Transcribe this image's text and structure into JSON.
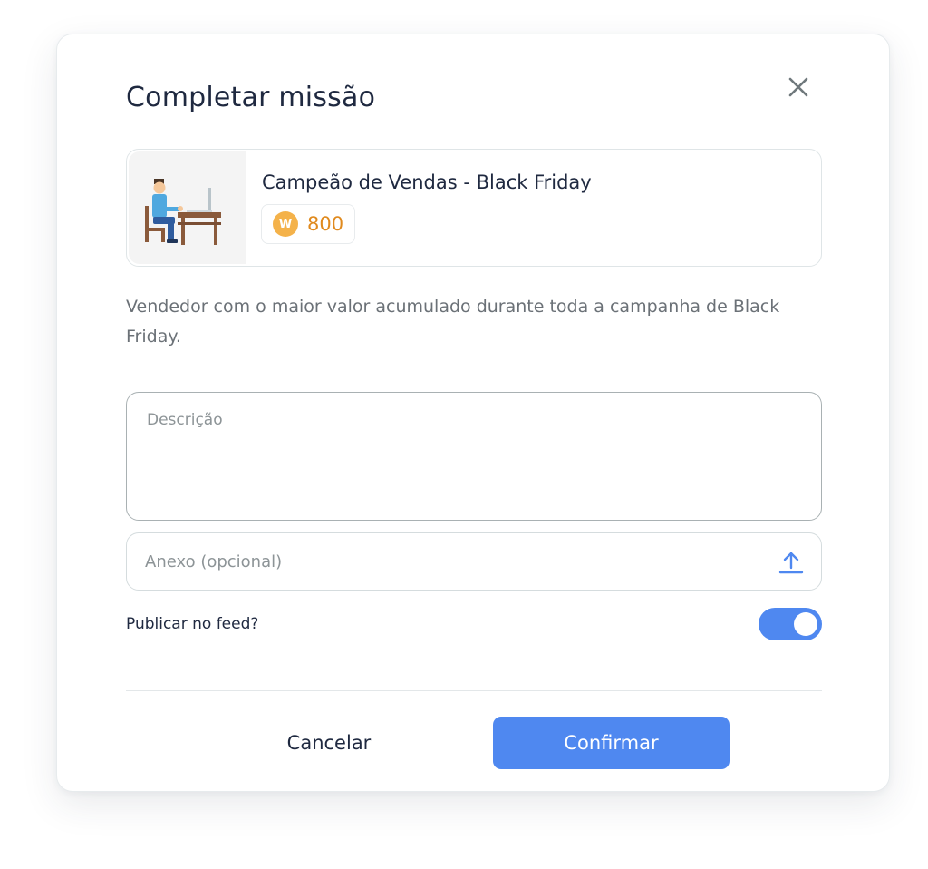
{
  "modal": {
    "title": "Completar missão",
    "close_icon": "close-icon"
  },
  "mission": {
    "image_icon": "person-at-desk-illustration",
    "name": "Campeão de Vendas - Black Friday",
    "coin_letter": "W",
    "points": "800",
    "description": "Vendedor com o maior valor acumulado durante toda a campanha de Black Friday."
  },
  "form": {
    "description_placeholder": "Descrição",
    "description_value": "",
    "attachment_label": "Anexo (opcional)",
    "attachment_icon": "upload-icon",
    "publish_label": "Publicar no feed?",
    "publish_enabled": true
  },
  "footer": {
    "cancel_label": "Cancelar",
    "confirm_label": "Confirmar"
  },
  "colors": {
    "primary": "#4f88f0",
    "coin": "#f4b24a",
    "points_text": "#e08a1e",
    "title_text": "#1f2940"
  }
}
